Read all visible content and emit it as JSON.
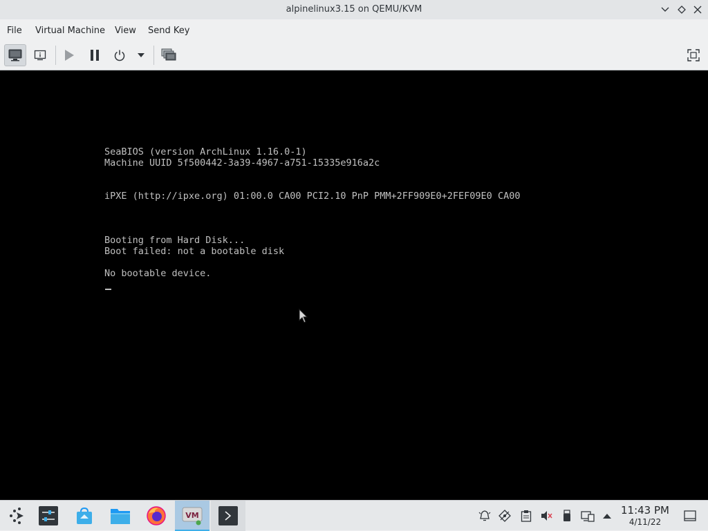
{
  "window": {
    "title": "alpinelinux3.15 on QEMU/KVM"
  },
  "menu": {
    "file": "File",
    "virtual_machine": "Virtual Machine",
    "view": "View",
    "send_key": "Send Key"
  },
  "toolbar": {
    "icons": [
      "console-icon",
      "details-icon",
      "run-icon",
      "pause-icon",
      "power-icon",
      "power-dropdown-icon",
      "snapshots-icon",
      "fullscreen-icon"
    ]
  },
  "console": {
    "lines": [
      "SeaBIOS (version ArchLinux 1.16.0-1)",
      "Machine UUID 5f500442-3a39-4967-a751-15335e916a2c",
      "iPXE (http://ipxe.org) 01:00.0 CA00 PCI2.10 PnP PMM+2FF909E0+2FEF09E0 CA00",
      "Booting from Hard Disk...",
      "Boot failed: not a bootable disk",
      "No bootable device."
    ]
  },
  "taskbar": {
    "apps": [
      "application-launcher-icon",
      "system-settings-icon",
      "discover-store-icon",
      "file-manager-icon",
      "firefox-icon",
      "virt-manager-icon",
      "terminal-icon"
    ],
    "tray": [
      "notifications-icon",
      "connect-icon",
      "clipboard-icon",
      "volume-muted-icon",
      "usb-icon",
      "network-icon",
      "expand-tray-icon"
    ],
    "clock": {
      "time": "11:43 PM",
      "date": "4/11/22"
    }
  },
  "colors": {
    "accent": "#3daee9",
    "console_bg": "#000000",
    "console_text": "#c0c0c0"
  }
}
